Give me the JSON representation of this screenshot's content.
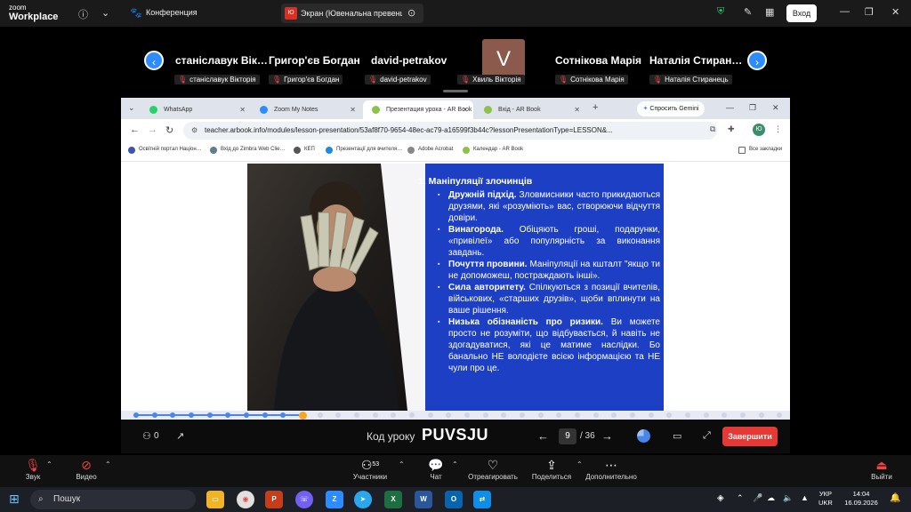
{
  "zoom": {
    "brand_line1": "zoom",
    "brand_line2": "Workplace",
    "meeting_label": "Конференция",
    "share_tab_badge": "Ю",
    "share_tab_title": "Экран (Ювенальна превенція Л",
    "login_label": "Вход"
  },
  "participants": {
    "big_names": [
      "станіславук Вік…",
      "Григор'єв Богдан",
      "david-petrakov",
      "Сотнікова Марія",
      "Наталія Стиран…"
    ],
    "small_names": [
      "станіславук Вікторія",
      "Григор'єв Богдан",
      "david-petrakov",
      "Хвиль Вікторія",
      "Сотнікова Марія",
      "Наталія Стиранець"
    ],
    "avatar_letter": "V",
    "prev_icon": "‹",
    "next_icon": "›"
  },
  "browser": {
    "tabs": [
      {
        "title": "WhatsApp",
        "color": "#25d366"
      },
      {
        "title": "Zoom My Notes",
        "color": "#2d8cff"
      },
      {
        "title": "Презентация урока - AR Book",
        "color": "#8bc34a"
      },
      {
        "title": "Вхід - AR Book",
        "color": "#8bc34a"
      }
    ],
    "new_tab": "+",
    "gemini_label": "Спросить Gemini",
    "url": "teacher.arbook.info/modules/lesson-presentation/53af8f70-9654-48ec-ac79-a16599f3b44c?lessonPresentationType=LESSON&...",
    "profile_letter": "Ю",
    "bookmarks": [
      {
        "title": "Освітній портал Націон…",
        "color": "#3f51b5"
      },
      {
        "title": "Вхід до Zimbra Web Clie…",
        "color": "#607d8b"
      },
      {
        "title": "КЕП",
        "color": "#555"
      },
      {
        "title": "Презентації для вчителя…",
        "color": "#1e88e5"
      },
      {
        "title": "Adobe Acrobat",
        "color": "#888"
      },
      {
        "title": "Календар - AR Book",
        "color": "#8bc34a"
      }
    ],
    "all_bookmarks": "Все закладки"
  },
  "slide": {
    "heading": "1. Маніпуляції злочинців",
    "items": [
      {
        "bold": "Дружній підхід.",
        "text": " Зловмисники часто прикидаються друзями, які «розуміють» вас, створюючи відчуття довіри."
      },
      {
        "bold": "Винагорода.",
        "text": " Обіцяють гроші, подарунки, «привілеї» або популярність за виконання завдань."
      },
      {
        "bold": "Почуття провини.",
        "text": " Маніпуляції на кшталт \"якщо ти не допоможеш, постраждають інші»."
      },
      {
        "bold": "Сила авторитету.",
        "text": " Спілкуються з позиції вчителів, військових, «старших друзів», щоби вплинути на ваше рішення."
      },
      {
        "bold": "Низька обізнаність про ризики.",
        "text": " Ви можете просто не розуміти, що відбувається, й навіть не здогадуватися, які це матиме наслідки. Бо банально НЕ володієте всією інформацією та НЕ чули про це."
      }
    ]
  },
  "arbook": {
    "participants_count": "0",
    "lesson_code_label": "Код уроку",
    "lesson_code": "PUVSJU",
    "current_page": "9",
    "total_pages": "/ 36",
    "finish_label": "Завершити",
    "progress_fraction": 0.25
  },
  "zoom_toolbar": {
    "audio": "Звук",
    "video": "Видео",
    "participants": "Участники",
    "participants_count": "53",
    "chat": "Чат",
    "react": "Отреагировать",
    "share": "Поделиться",
    "more": "Дополнительно",
    "leave": "Выйти"
  },
  "taskbar": {
    "search_placeholder": "Пошук",
    "lang_line1": "УКР",
    "lang_line2": "UKR",
    "time": "14:04",
    "date": "16.09.2026"
  },
  "colors": {
    "slide_blue": "#1d3fc4",
    "zoom_blue": "#2d8cff",
    "finish_red": "#e53935",
    "progress_active": "#4a86e8",
    "progress_current": "#f5a623"
  }
}
